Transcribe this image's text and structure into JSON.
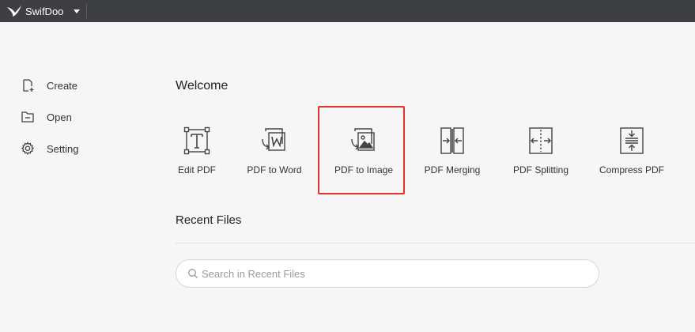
{
  "titlebar": {
    "app_name": "SwifDoo",
    "logo_icon": "swift-bird-icon",
    "menu_icon": "caret-down-icon"
  },
  "sidebar": {
    "items": [
      {
        "label": "Create",
        "icon": "new-file-icon"
      },
      {
        "label": "Open",
        "icon": "folder-icon"
      },
      {
        "label": "Setting",
        "icon": "gear-icon"
      }
    ]
  },
  "main": {
    "welcome_title": "Welcome",
    "tools": [
      {
        "label": "Edit PDF",
        "icon": "text-edit-icon"
      },
      {
        "label": "PDF to Word",
        "icon": "pdf-to-word-icon"
      },
      {
        "label": "PDF to Image",
        "icon": "pdf-to-image-icon",
        "highlighted": true
      },
      {
        "label": "PDF Merging",
        "icon": "merge-icon"
      },
      {
        "label": "PDF Splitting",
        "icon": "split-icon"
      },
      {
        "label": "Compress PDF",
        "icon": "compress-icon"
      }
    ],
    "recent_title": "Recent Files",
    "search": {
      "placeholder": "Search in Recent Files",
      "value": ""
    }
  },
  "colors": {
    "titlebar": "#3d3f42",
    "background": "#f6f6f6",
    "highlight": "#e5302b",
    "icon_stroke": "#444444"
  }
}
